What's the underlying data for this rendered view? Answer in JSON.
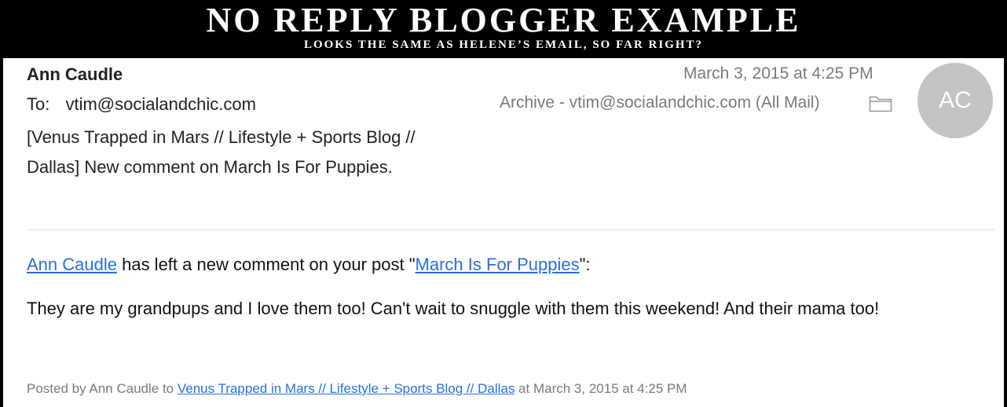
{
  "banner": {
    "title": "NO REPLY BLOGGER EXAMPLE",
    "subtitle": "LOOKS THE SAME AS HELENE’S EMAIL, SO FAR RIGHT?"
  },
  "email": {
    "sender": "Ann Caudle",
    "to_label": "To:",
    "to_address": "vtim@socialandchic.com",
    "subject": "[Venus Trapped in Mars // Lifestyle + Sports Blog // Dallas] New comment on March Is For Puppies.",
    "date": "March 3, 2015 at 4:25 PM",
    "mailbox": "Archive - vtim@socialandchic.com (All Mail)",
    "mailbox_icon": "folder-icon",
    "avatar_initials": "AC"
  },
  "body": {
    "commenter_link": "Ann Caudle",
    "comment_intro": " has left a new comment on your post \"",
    "post_link": "March Is For Puppies",
    "comment_intro_end": "\":",
    "comment_text": "They are my grandpups and I love them too! Can't wait to snuggle with them this weekend! And their mama too!",
    "posted_by_prefix": "Posted by Ann Caudle to ",
    "blog_link": "Venus Trapped in Mars // Lifestyle + Sports Blog // Dallas",
    "posted_by_suffix": " at March 3, 2015 at 4:25 PM"
  },
  "colors": {
    "link": "#2b6fe0",
    "muted_text": "#7a7a7a",
    "avatar_bg": "#c4c4c4",
    "banner_bg": "#000000"
  }
}
